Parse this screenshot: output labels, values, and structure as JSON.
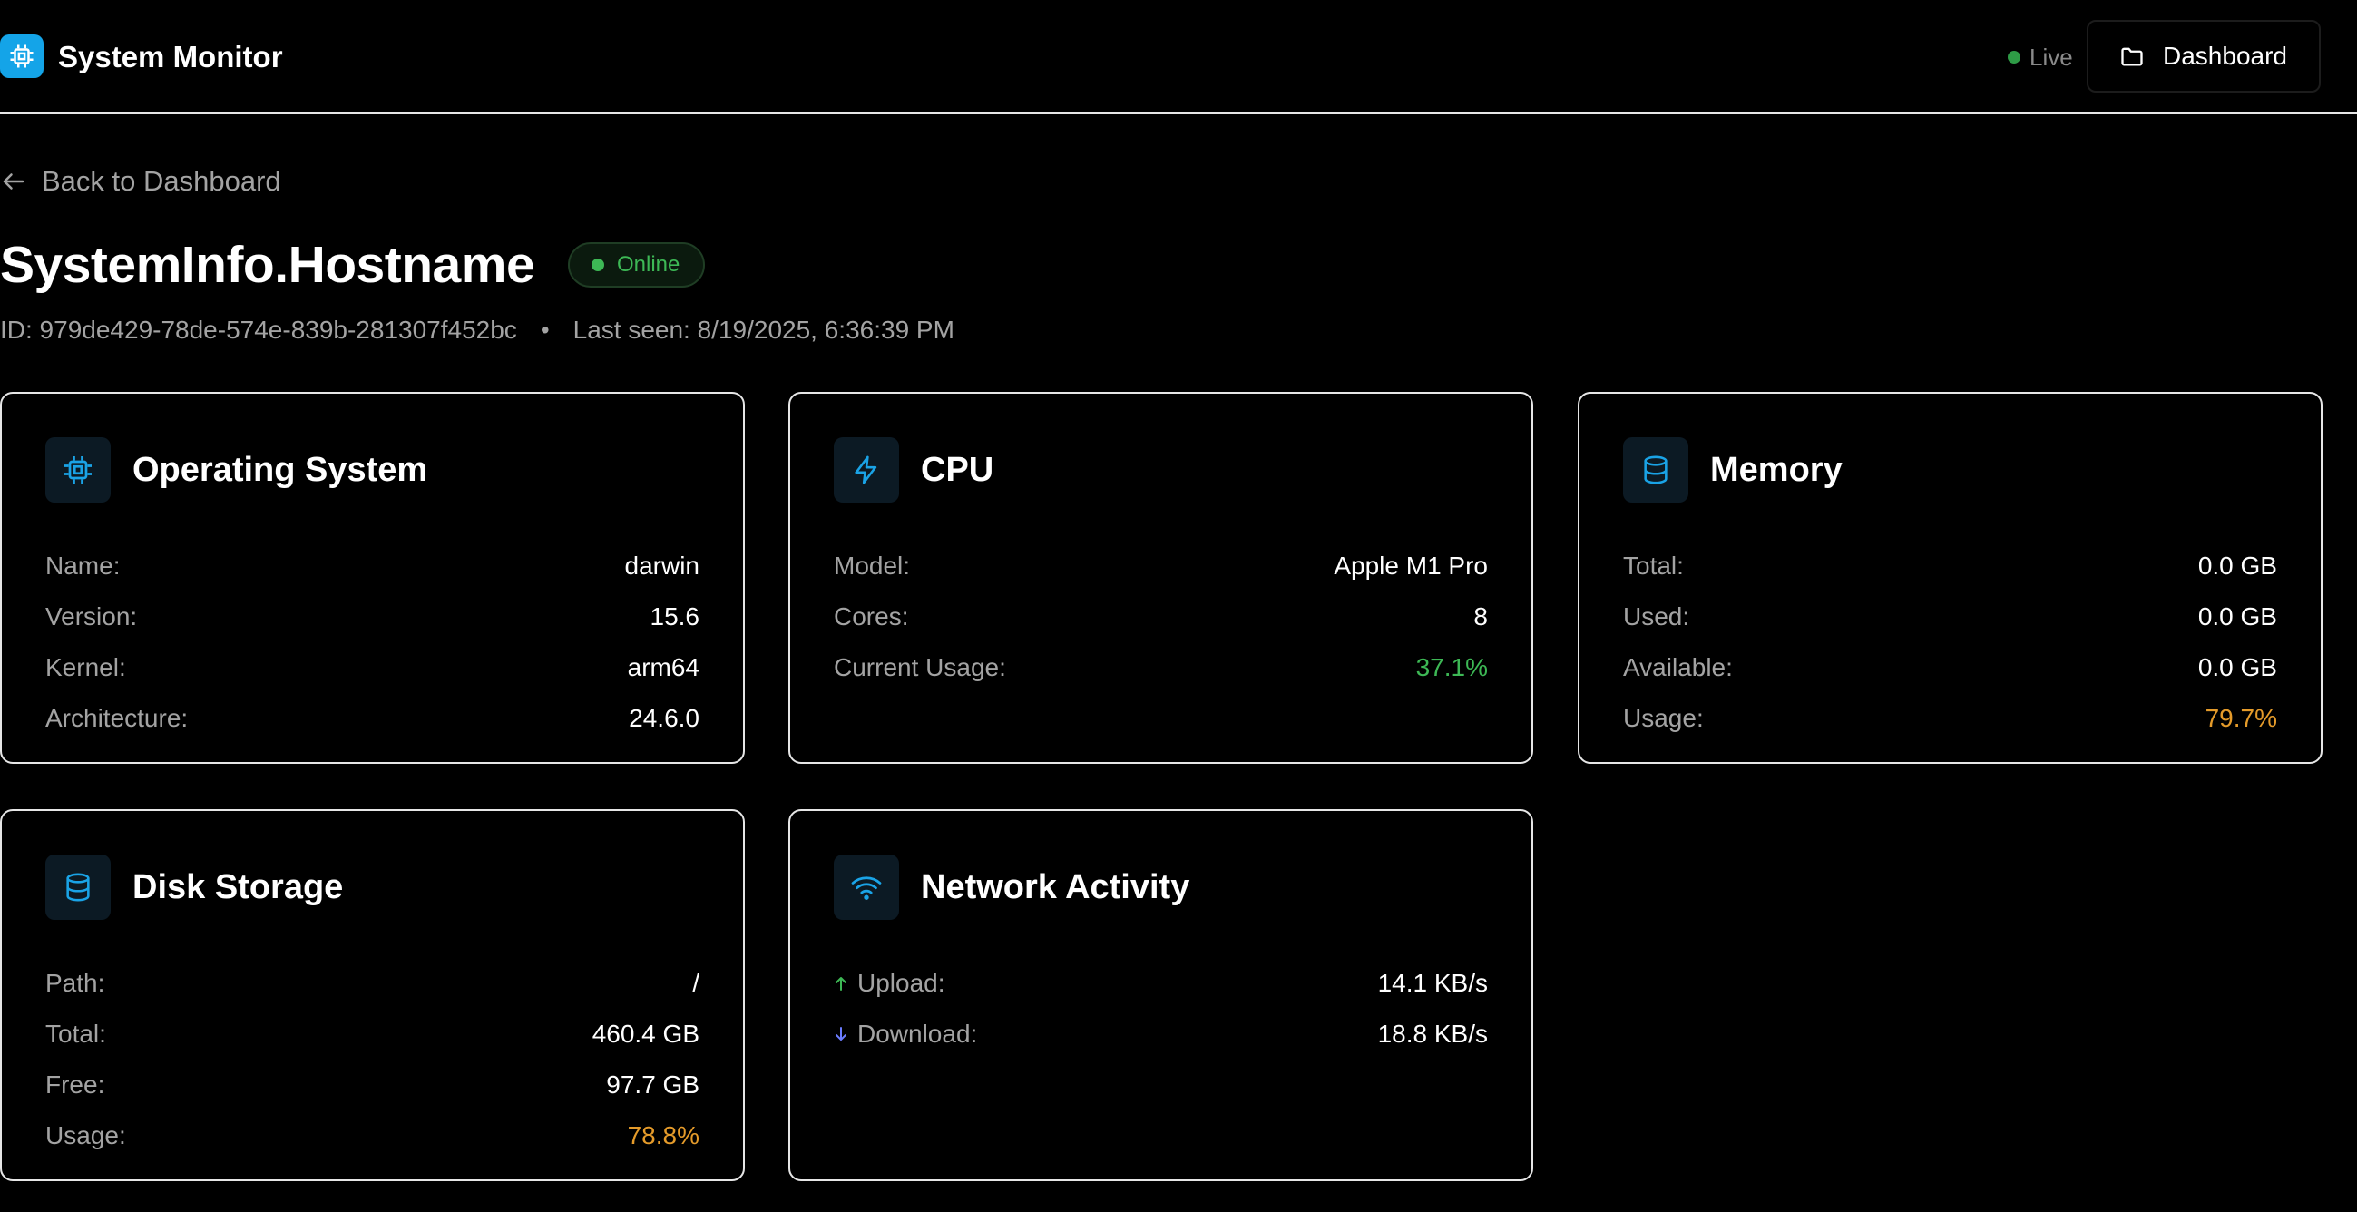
{
  "header": {
    "app_title": "System Monitor",
    "live_label": "Live",
    "dashboard_button": "Dashboard"
  },
  "back_link": "Back to Dashboard",
  "host": {
    "title": "SystemInfo.Hostname",
    "status": "Online",
    "id": "ID: 979de429-78de-574e-839b-281307f452bc",
    "separator": "•",
    "last_seen": "Last seen: 8/19/2025, 6:36:39 PM"
  },
  "cards": {
    "os": {
      "title": "Operating System",
      "icon": "cpu-chip-icon",
      "rows": [
        {
          "label": "Name:",
          "value": "darwin"
        },
        {
          "label": "Version:",
          "value": "15.6"
        },
        {
          "label": "Kernel:",
          "value": "arm64"
        },
        {
          "label": "Architecture:",
          "value": "24.6.0"
        }
      ]
    },
    "cpu": {
      "title": "CPU",
      "icon": "lightning-icon",
      "rows": [
        {
          "label": "Model:",
          "value": "Apple M1 Pro"
        },
        {
          "label": "Cores:",
          "value": "8"
        },
        {
          "label": "Current Usage:",
          "value": "37.1%"
        }
      ]
    },
    "memory": {
      "title": "Memory",
      "icon": "database-icon",
      "rows": [
        {
          "label": "Total:",
          "value": "0.0 GB"
        },
        {
          "label": "Used:",
          "value": "0.0 GB"
        },
        {
          "label": "Available:",
          "value": "0.0 GB"
        },
        {
          "label": "Usage:",
          "value": "79.7%"
        }
      ]
    },
    "disk": {
      "title": "Disk Storage",
      "icon": "database-icon",
      "rows": [
        {
          "label": "Path:",
          "value": "/"
        },
        {
          "label": "Total:",
          "value": "460.4 GB"
        },
        {
          "label": "Free:",
          "value": "97.7 GB"
        },
        {
          "label": "Usage:",
          "value": "78.8%"
        }
      ]
    },
    "network": {
      "title": "Network Activity",
      "icon": "wifi-icon",
      "rows": [
        {
          "label": "Upload:",
          "value": "14.1 KB/s",
          "icon": "arrow-up-icon"
        },
        {
          "label": "Download:",
          "value": "18.8 KB/s",
          "icon": "arrow-down-icon"
        }
      ]
    }
  },
  "colors": {
    "accent": "#14a4e8",
    "ok": "#3db855",
    "warn": "#e59b2a",
    "upload": "#3db855",
    "download": "#6b7cff"
  }
}
